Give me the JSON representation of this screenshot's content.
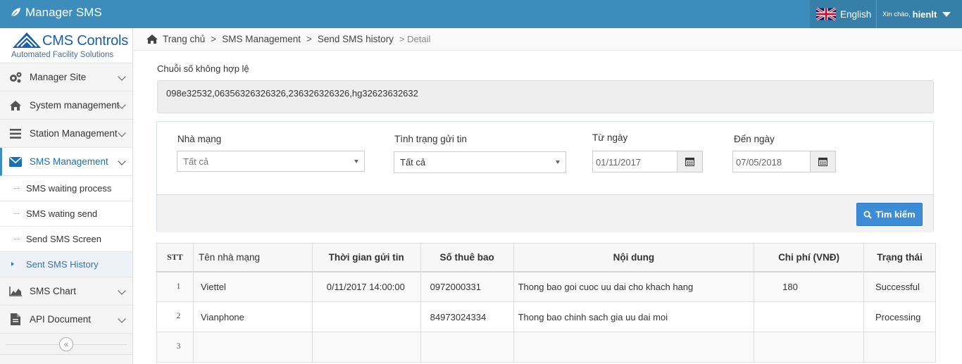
{
  "app": {
    "title": "Manager SMS"
  },
  "header": {
    "language": "English",
    "greeting": "Xin chào,",
    "username": "hienlt"
  },
  "logo": {
    "name": "CMS Controls",
    "tagline": "Automated Facility Solutions"
  },
  "sidebar": {
    "items": [
      {
        "label": "Manager Site",
        "icon": "gears-icon"
      },
      {
        "label": "System management",
        "icon": "home-icon"
      },
      {
        "label": "Station Management",
        "icon": "bars-icon"
      },
      {
        "label": "SMS Management",
        "icon": "envelope-icon"
      },
      {
        "label": "SMS Chart",
        "icon": "area-chart-icon"
      },
      {
        "label": "API Document",
        "icon": "file-icon"
      }
    ],
    "sms_sub": [
      {
        "label": "SMS waiting process"
      },
      {
        "label": "SMS wating send"
      },
      {
        "label": "Send SMS Screen"
      },
      {
        "label": "Sent SMS History"
      }
    ]
  },
  "breadcrumb": {
    "home": "Trang chủ",
    "sep": ">",
    "b1": "SMS Management",
    "b2": "Send SMS history",
    "last": "> Detail"
  },
  "invalid": {
    "label": "Chuỗi số không hợp lệ",
    "value": "098e32532,06356326326326,236326326326,hg32623632632"
  },
  "filters": {
    "network_label": "Nhà mạng",
    "network_value": "Tất cả",
    "status_label": "Tình trạng gửi tin",
    "status_value": "Tất cả",
    "from_label": "Từ ngày",
    "from_value": "01/11/2017",
    "to_label": "Đến ngày",
    "to_value": "07/05/2018",
    "search_label": "Tìm kiếm"
  },
  "table": {
    "columns": [
      "STT",
      "Tên nhà mạng",
      "Thời gian gửi tin",
      "Số thuê bao",
      "Nội dung",
      "Chi phí (VNĐ)",
      "Trạng thái"
    ],
    "rows": [
      {
        "stt": "1",
        "network": "Viettel",
        "time": "0/11/2017 14:00:00",
        "phone": "0972000331",
        "content": "Thong bao goi cuoc uu dai cho khach hang",
        "cost": "180",
        "status": "Successful"
      },
      {
        "stt": "2",
        "network": "Vianphone",
        "time": "",
        "phone": "84973024334",
        "content": "Thong bao chinh sach gia uu dai moi",
        "cost": "",
        "status": "Processing"
      },
      {
        "stt": "3",
        "network": "",
        "time": "",
        "phone": "",
        "content": "",
        "cost": "",
        "status": ""
      }
    ]
  }
}
